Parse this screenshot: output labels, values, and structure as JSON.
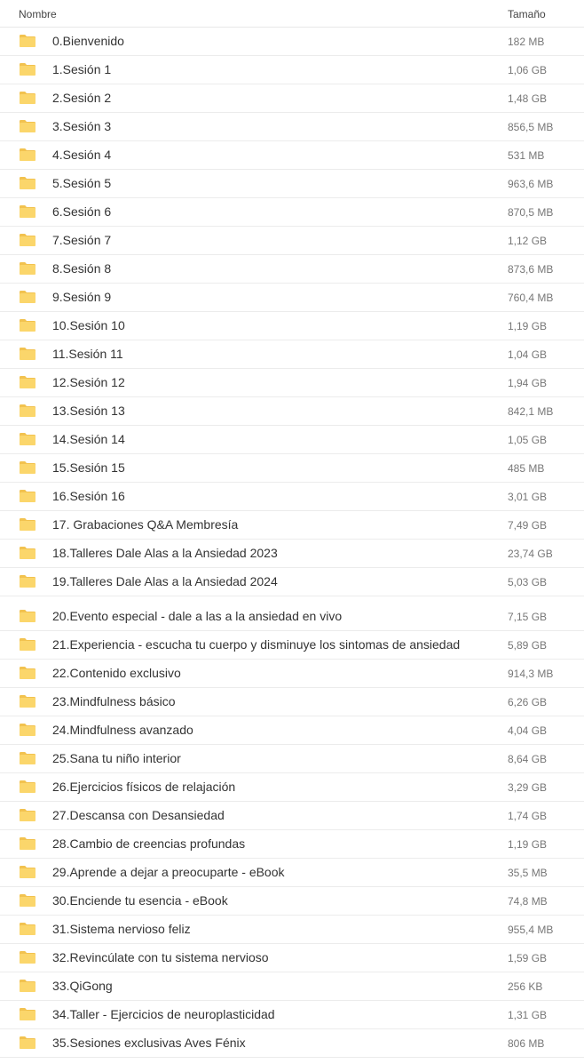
{
  "header": {
    "name_label": "Nombre",
    "size_label": "Tamaño"
  },
  "colors": {
    "folder_back": "#f2c24f",
    "folder_front": "#fbd66b",
    "divider": "#ececec"
  },
  "icon": "folder-icon",
  "rows": [
    {
      "name": "0.Bienvenido",
      "size": "182 MB"
    },
    {
      "name": "1.Sesión 1",
      "size": "1,06 GB"
    },
    {
      "name": "2.Sesión 2",
      "size": "1,48 GB"
    },
    {
      "name": "3.Sesión 3",
      "size": "856,5 MB"
    },
    {
      "name": "4.Sesión 4",
      "size": "531 MB"
    },
    {
      "name": "5.Sesión 5",
      "size": "963,6 MB"
    },
    {
      "name": "6.Sesión 6",
      "size": "870,5 MB"
    },
    {
      "name": "7.Sesión 7",
      "size": "1,12 GB"
    },
    {
      "name": "8.Sesión 8",
      "size": "873,6 MB"
    },
    {
      "name": "9.Sesión 9",
      "size": "760,4 MB"
    },
    {
      "name": "10.Sesión 10",
      "size": "1,19 GB"
    },
    {
      "name": "11.Sesión 11",
      "size": "1,04 GB"
    },
    {
      "name": "12.Sesión 12",
      "size": "1,94 GB"
    },
    {
      "name": "13.Sesión 13",
      "size": "842,1 MB"
    },
    {
      "name": "14.Sesión 14",
      "size": "1,05 GB"
    },
    {
      "name": "15.Sesión 15",
      "size": "485 MB"
    },
    {
      "name": "16.Sesión 16",
      "size": "3,01 GB"
    },
    {
      "name": "17. Grabaciones Q&A Membresía",
      "size": "7,49 GB"
    },
    {
      "name": "18.Talleres Dale Alas a la Ansiedad 2023",
      "size": "23,74 GB"
    },
    {
      "name": "19.Talleres Dale Alas a la Ansiedad 2024",
      "size": "5,03 GB"
    },
    {
      "name": "20.Evento especial - dale a las a la ansiedad en vivo",
      "size": "7,15 GB"
    },
    {
      "name": "21.Experiencia - escucha tu cuerpo y disminuye los sintomas de ansiedad",
      "size": "5,89 GB"
    },
    {
      "name": "22.Contenido exclusivo",
      "size": "914,3 MB"
    },
    {
      "name": "23.Mindfulness básico",
      "size": "6,26 GB"
    },
    {
      "name": "24.Mindfulness avanzado",
      "size": "4,04 GB"
    },
    {
      "name": "25.Sana tu niño interior",
      "size": "8,64 GB"
    },
    {
      "name": "26.Ejercicios físicos de relajación",
      "size": "3,29 GB"
    },
    {
      "name": "27.Descansa con Desansiedad",
      "size": "1,74 GB"
    },
    {
      "name": "28.Cambio de creencias profundas",
      "size": "1,19 GB"
    },
    {
      "name": "29.Aprende a dejar a preocuparte - eBook",
      "size": "35,5 MB"
    },
    {
      "name": "30.Enciende tu esencia - eBook",
      "size": "74,8 MB"
    },
    {
      "name": "31.Sistema nervioso feliz",
      "size": "955,4 MB"
    },
    {
      "name": "32.Revincúlate con tu sistema nervioso",
      "size": "1,59 GB"
    },
    {
      "name": "33.QiGong",
      "size": "256 KB"
    },
    {
      "name": "34.Taller - Ejercicios de neuroplasticidad",
      "size": "1,31 GB"
    },
    {
      "name": "35.Sesiones exclusivas Aves Fénix",
      "size": "806 MB"
    }
  ]
}
